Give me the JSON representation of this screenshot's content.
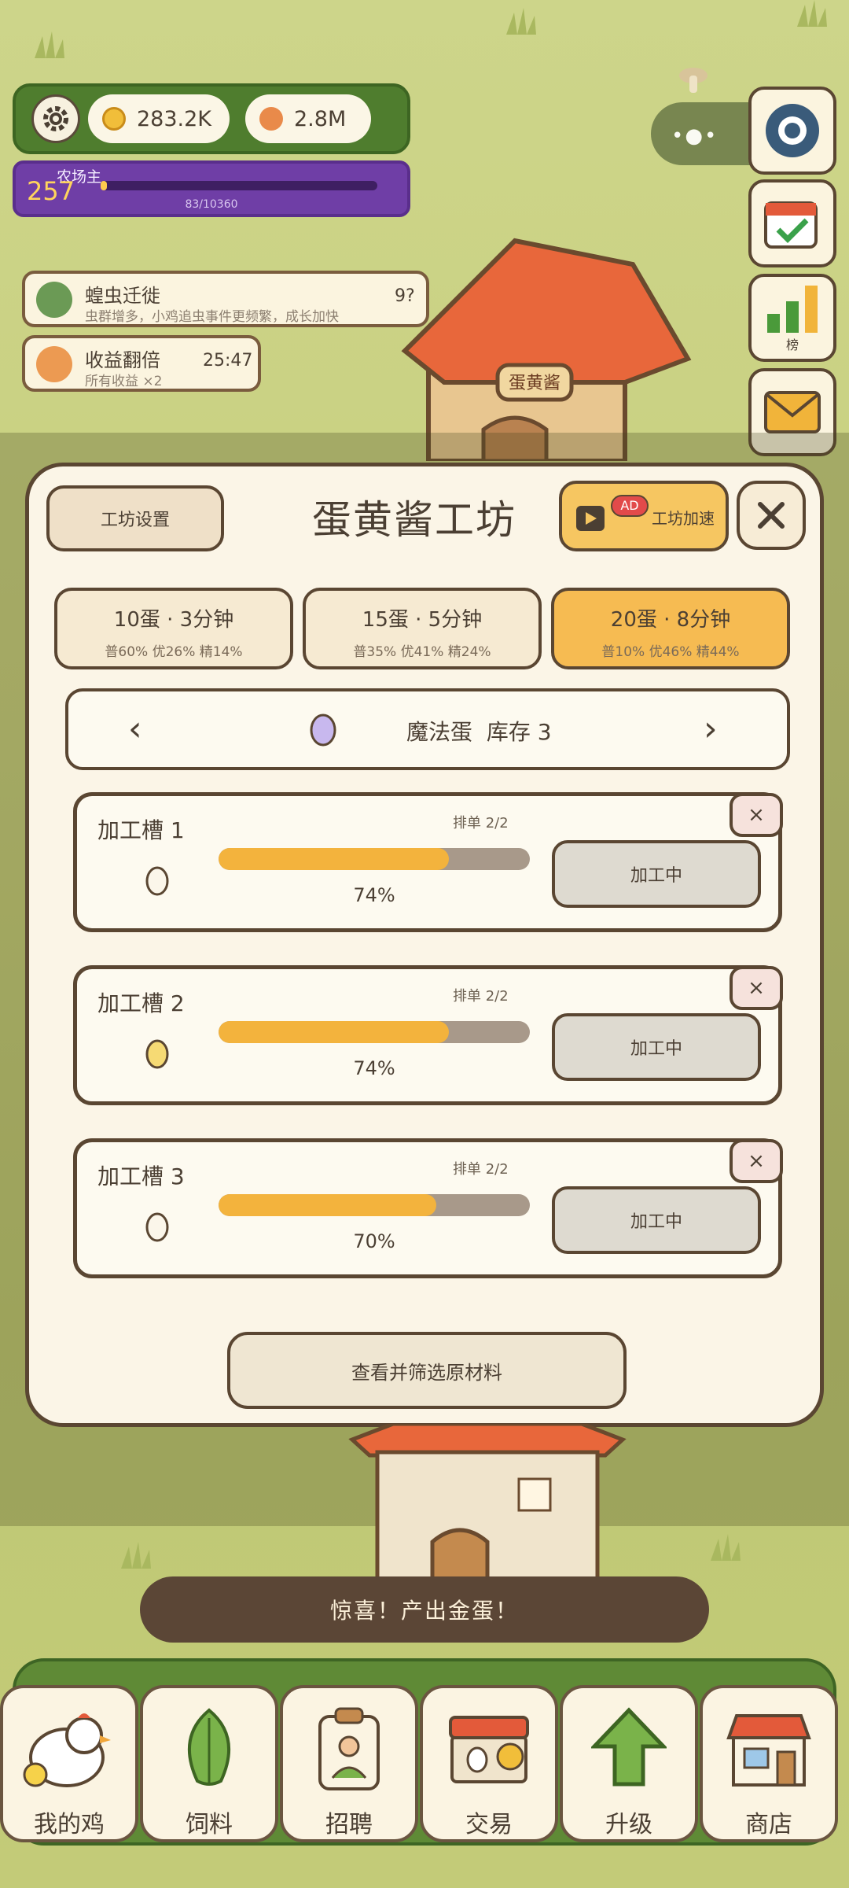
{
  "header": {
    "coins": "283.2K",
    "gems": "2.8M",
    "level_title": "农场主",
    "level": "257",
    "level_progress": "83/10360",
    "level_progress_fraction": 0.008
  },
  "side": {
    "rank_label": "榜"
  },
  "events": [
    {
      "title": "蝗虫迁徙",
      "desc": "虫群增多，小鸡追虫事件更频繁，成长加快",
      "right": "9?"
    },
    {
      "title": "收益翻倍",
      "desc": "所有收益 ×2",
      "right": "25:47"
    }
  ],
  "house_sign": "蛋黄酱",
  "panel": {
    "settings_label": "工坊设置",
    "title": "蛋黄酱工坊",
    "ad_badge": "AD",
    "speed_label": "工坊加速",
    "modes": [
      {
        "label": "10蛋 · 3分钟",
        "odds": "普60% 优26% 精14%",
        "active": false
      },
      {
        "label": "15蛋 · 5分钟",
        "odds": "普35% 优41% 精24%",
        "active": false
      },
      {
        "label": "20蛋 · 8分钟",
        "odds": "普10% 优46% 精44%",
        "active": true
      }
    ],
    "selector": {
      "prev": "‹",
      "next": "›",
      "egg_name": "魔法蛋",
      "stock": "库存 3"
    },
    "slots": [
      {
        "name": "加工槽 1",
        "queue": "排单 2/2",
        "progress": 0.74,
        "percent": "74%",
        "status": "加工中",
        "close": "×",
        "egg_color": "#fbf6ea"
      },
      {
        "name": "加工槽 2",
        "queue": "排单 2/2",
        "progress": 0.74,
        "percent": "74%",
        "status": "加工中",
        "close": "×",
        "egg_color": "#f6da74"
      },
      {
        "name": "加工槽 3",
        "queue": "排单 2/2",
        "progress": 0.7,
        "percent": "70%",
        "status": "加工中",
        "close": "×",
        "egg_color": "#fbf6ea"
      }
    ],
    "view_button": "查看并筛选原材料"
  },
  "toast": "惊喜！产出金蛋！",
  "nav": [
    {
      "label": "我的鸡",
      "icon": "chicken-icon"
    },
    {
      "label": "饲料",
      "icon": "leaf-icon"
    },
    {
      "label": "招聘",
      "icon": "badge-icon"
    },
    {
      "label": "交易",
      "icon": "market-icon"
    },
    {
      "label": "升级",
      "icon": "arrow-up-icon"
    },
    {
      "label": "商店",
      "icon": "shop-icon"
    }
  ],
  "colors": {
    "accent": "#f6bb52",
    "panel": "#fbf5e7",
    "border": "#5a4632",
    "nav_green": "#5f8a36",
    "level_purple": "#6f3ea6"
  }
}
